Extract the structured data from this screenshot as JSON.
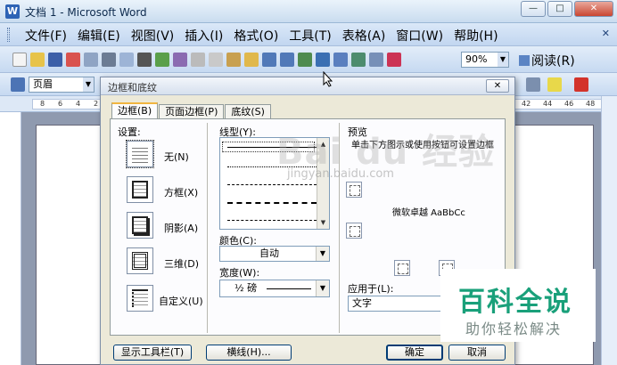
{
  "window": {
    "title": "文档 1 - Microsoft Word",
    "min_label": "—",
    "max_label": "□",
    "close_label": "✕"
  },
  "menu": [
    "文件(F)",
    "编辑(E)",
    "视图(V)",
    "插入(I)",
    "格式(O)",
    "工具(T)",
    "表格(A)",
    "窗口(W)",
    "帮助(H)"
  ],
  "toolbar": {
    "zoom": "90%",
    "read_label": "阅读(R)",
    "style_value": "页眉"
  },
  "ruler_numbers": [
    "8",
    "6",
    "4",
    "2",
    "42",
    "44",
    "46",
    "48"
  ],
  "dialog": {
    "title": "边框和底纹",
    "close": "✕",
    "tabs": [
      "边框(B)",
      "页面边框(P)",
      "底纹(S)"
    ],
    "settings_label": "设置:",
    "settings": [
      "无(N)",
      "方框(X)",
      "阴影(A)",
      "三维(D)",
      "自定义(U)"
    ],
    "linestyle_label": "线型(Y):",
    "color_label": "颜色(C):",
    "color_value": "自动",
    "width_label": "宽度(W):",
    "width_value": "½ 磅",
    "preview_label": "预览",
    "preview_hint": "单击下方图示或使用按钮可设置边框",
    "sample_text": "微软卓越  AaBbCc",
    "apply_label": "应用于(L):",
    "apply_value": "文字",
    "btn_toolbar": "显示工具栏(T)",
    "btn_hline": "横线(H)...",
    "btn_ok": "确定",
    "btn_cancel": "取消"
  },
  "watermark": {
    "baidu": "Bai du 经验",
    "url": "jingyan.baidu.com"
  },
  "brand": {
    "big": "百科全说",
    "small": "助你轻松解决"
  }
}
